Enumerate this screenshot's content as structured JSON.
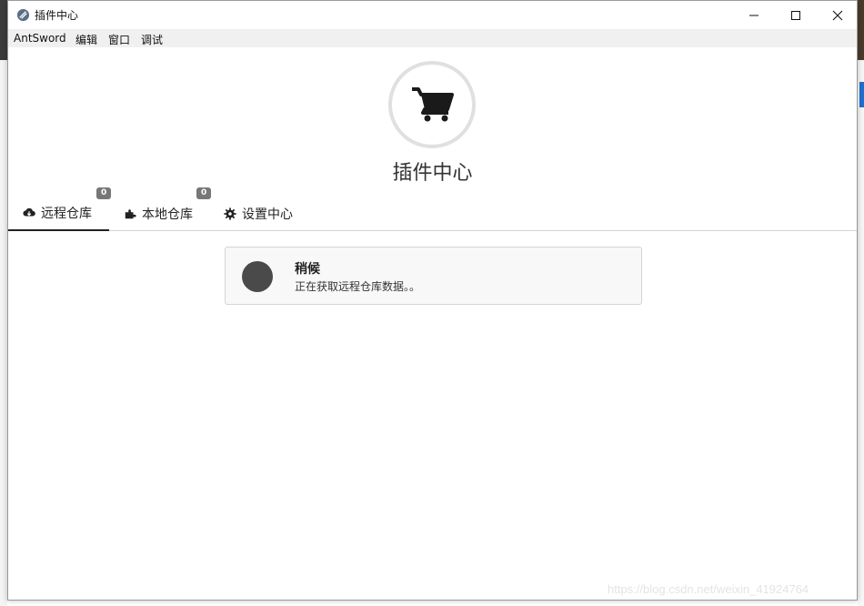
{
  "window": {
    "title": "插件中心"
  },
  "menu": {
    "items": [
      "AntSword",
      "编辑",
      "窗口",
      "调试"
    ]
  },
  "header": {
    "title": "插件中心",
    "icon": "shopping-cart-icon"
  },
  "tabs": [
    {
      "label": "远程仓库",
      "icon": "cloud-download-icon",
      "badge": "0",
      "active": true
    },
    {
      "label": "本地仓库",
      "icon": "puzzle-icon",
      "badge": "0",
      "active": false
    },
    {
      "label": "设置中心",
      "icon": "gear-icon",
      "active": false
    }
  ],
  "loading": {
    "title": "稍候",
    "message": "正在获取远程仓库数据。。"
  },
  "watermark": "https://blog.csdn.net/weixin_41924764",
  "colors": {
    "accent": "#222222",
    "badge": "#777777",
    "loader": "#4a4a4a"
  }
}
